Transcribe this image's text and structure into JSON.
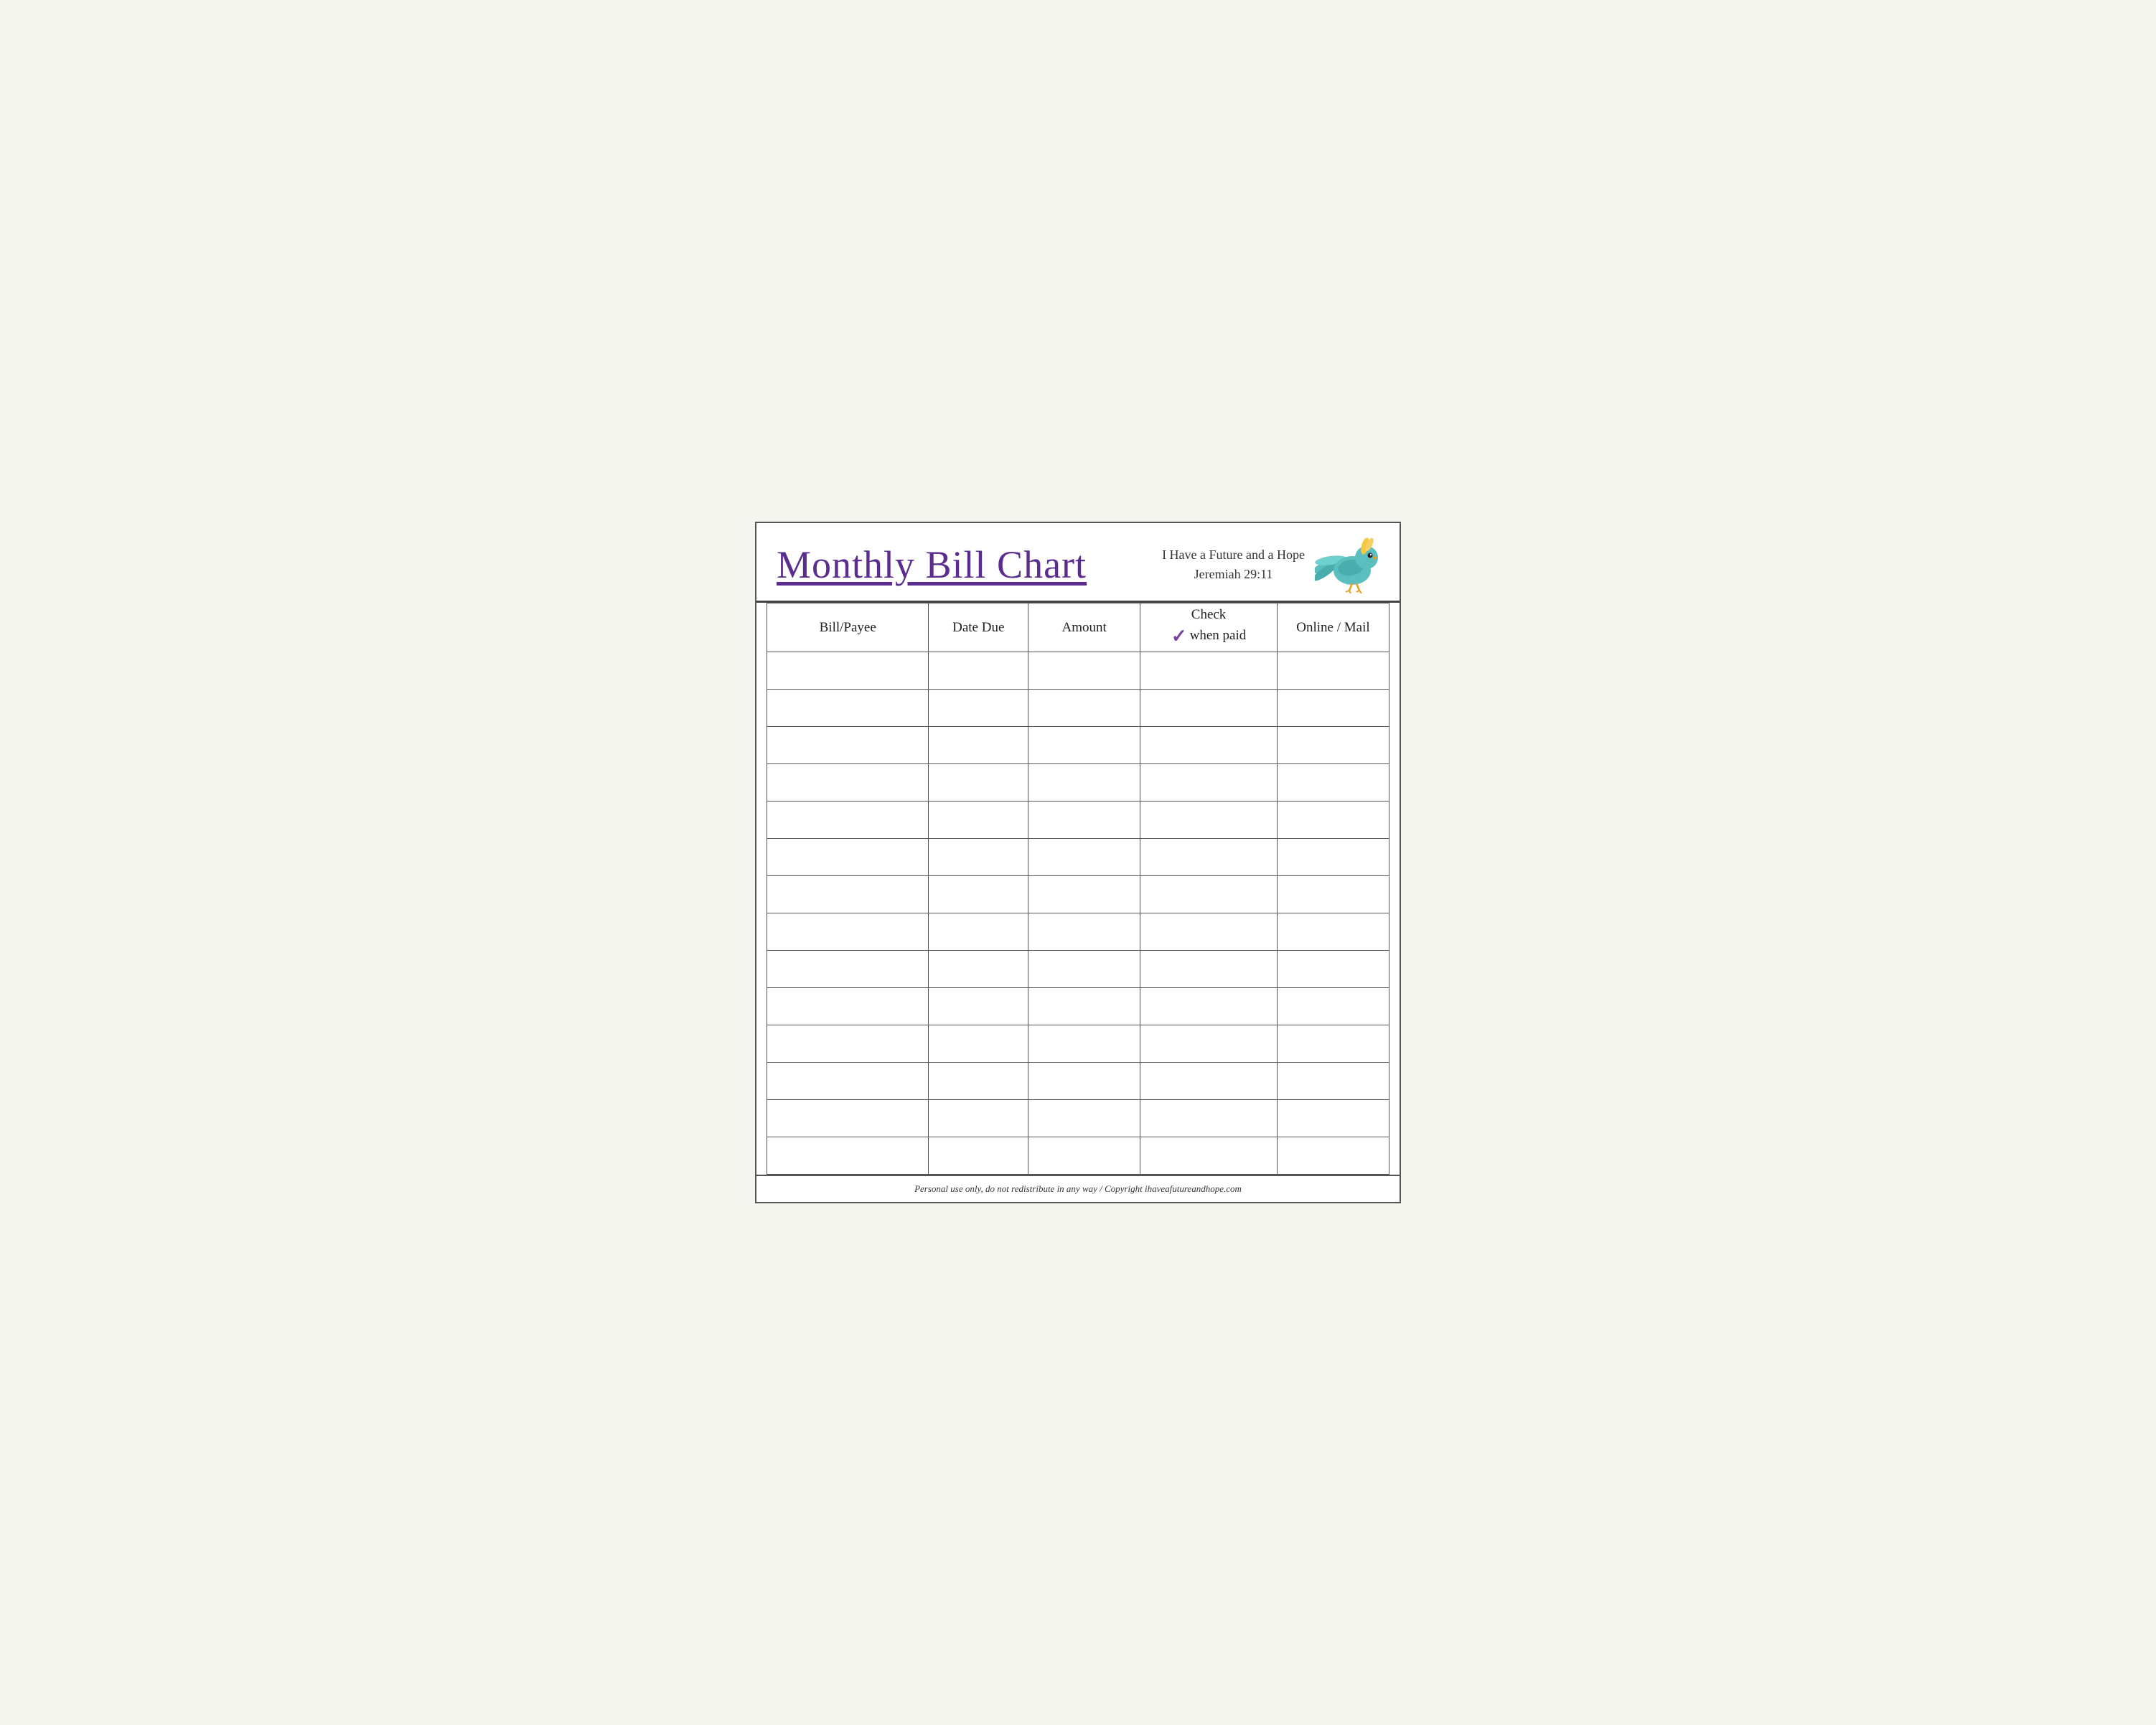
{
  "header": {
    "title": "Monthly Bill Chart",
    "verse_line1": "I Have a Future and a Hope",
    "verse_line2": "Jeremiah 29:11"
  },
  "columns": [
    {
      "id": "bill-payee",
      "label": "Bill/Payee"
    },
    {
      "id": "date-due",
      "label": "Date Due"
    },
    {
      "id": "amount",
      "label": "Amount"
    },
    {
      "id": "check-when-paid",
      "label_top": "Check",
      "label_bottom": "when paid",
      "checkmark": "✓"
    },
    {
      "id": "online-mail",
      "label": "Online / Mail"
    }
  ],
  "empty_rows": 14,
  "footer": "Personal use only, do not redistribute in any way / Copyright ihaveafutureandhope.com"
}
